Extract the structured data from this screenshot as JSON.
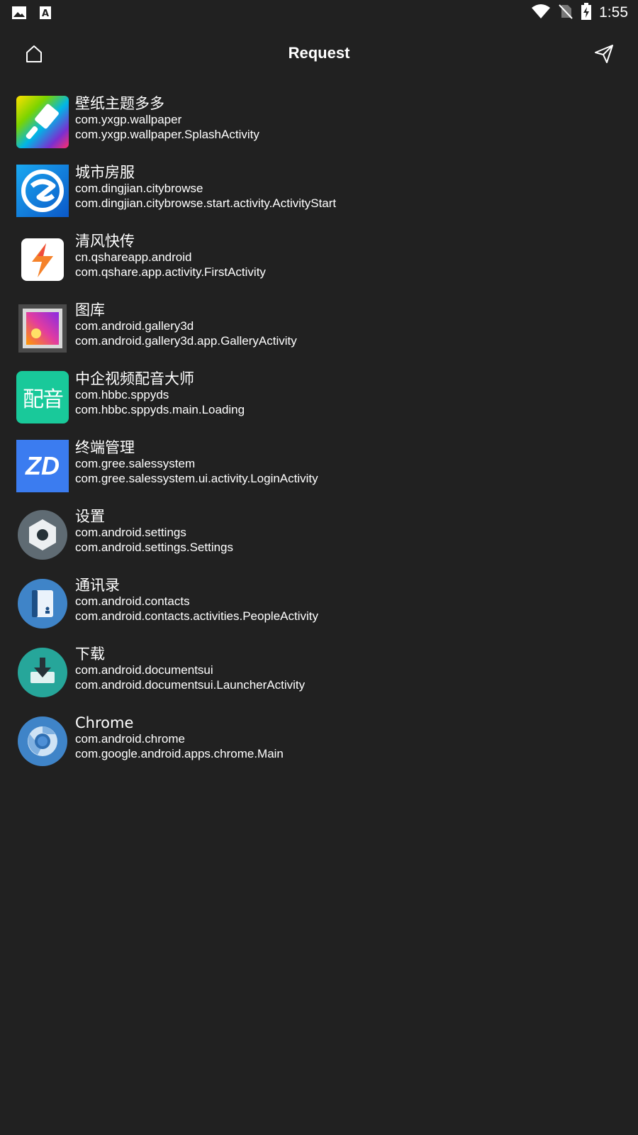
{
  "status_bar": {
    "time": "1:55",
    "left_icons": [
      "image-notification-icon",
      "text-notification-icon"
    ],
    "right_icons": [
      "wifi-icon",
      "no-sim-icon",
      "battery-charging-icon"
    ]
  },
  "toolbar": {
    "title": "Request",
    "left_icon": "home-icon",
    "right_icon": "send-icon"
  },
  "apps": [
    {
      "name": "壁纸主题多多",
      "package": "com.yxgp.wallpaper",
      "activity": "com.yxgp.wallpaper.SplashActivity",
      "icon": "wallpaper-app-icon"
    },
    {
      "name": "城市房服",
      "package": "com.dingjian.citybrowse",
      "activity": "com.dingjian.citybrowse.start.activity.ActivityStart",
      "icon": "city-house-app-icon"
    },
    {
      "name": "清风快传",
      "package": "cn.qshareapp.android",
      "activity": "com.qshare.app.activity.FirstActivity",
      "icon": "qshare-app-icon"
    },
    {
      "name": "图库",
      "package": "com.android.gallery3d",
      "activity": "com.android.gallery3d.app.GalleryActivity",
      "icon": "gallery-app-icon"
    },
    {
      "name": "中企视频配音大师",
      "package": "com.hbbc.sppyds",
      "activity": "com.hbbc.sppyds.main.Loading",
      "icon": "dubbing-app-icon",
      "icon_text": "配音"
    },
    {
      "name": "终端管理",
      "package": "com.gree.salessystem",
      "activity": "com.gree.salessystem.ui.activity.LoginActivity",
      "icon": "terminal-management-app-icon",
      "icon_text": "ZD"
    },
    {
      "name": "设置",
      "package": "com.android.settings",
      "activity": "com.android.settings.Settings",
      "icon": "settings-app-icon"
    },
    {
      "name": "通讯录",
      "package": "com.android.contacts",
      "activity": "com.android.contacts.activities.PeopleActivity",
      "icon": "contacts-app-icon"
    },
    {
      "name": "下载",
      "package": "com.android.documentsui",
      "activity": "com.android.documentsui.LauncherActivity",
      "icon": "downloads-app-icon"
    },
    {
      "name": "Chrome",
      "package": "com.android.chrome",
      "activity": "com.google.android.apps.chrome.Main",
      "icon": "chrome-app-icon"
    }
  ]
}
